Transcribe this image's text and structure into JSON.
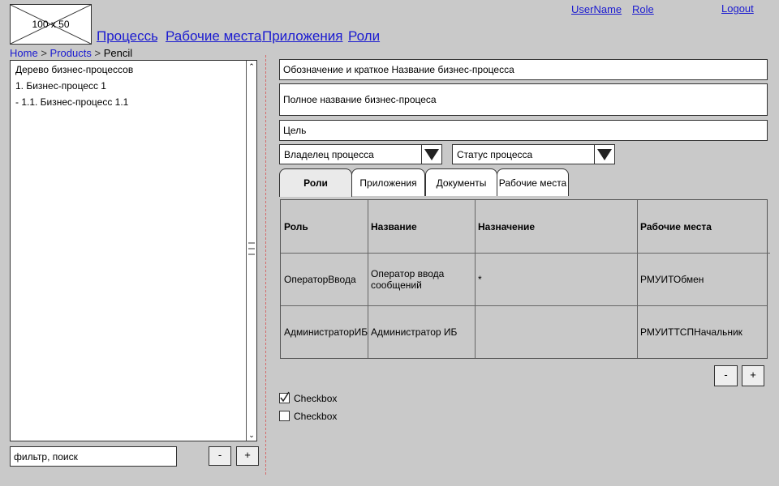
{
  "header": {
    "logo_text": "100 x 50",
    "user_name": "UserName",
    "role": "Role",
    "logout": "Logout",
    "nav": [
      "Процессы",
      "Рабочие места",
      "Приложения",
      "Роли"
    ]
  },
  "breadcrumb": [
    "Home",
    "Products",
    "Pencil"
  ],
  "tree": {
    "items": [
      "Дерево бизнес-процессов",
      "1. Бизнес-процесс 1",
      "- 1.1. Бизнес-процесс 1.1"
    ]
  },
  "filter": {
    "placeholder": "фильтр, поиск",
    "minus_label": "-",
    "plus_label": "+"
  },
  "form": {
    "short_name": "Обозначение и краткое Название бизнес-процесса",
    "full_name": "Полное название бизнес-процеса",
    "goal": "Цель",
    "owner": "Владелец процесса",
    "status": "Статус процесса"
  },
  "tabs": [
    "Роли",
    "Приложения",
    "Документы",
    "Рабочие места"
  ],
  "table": {
    "headers": [
      "Роль",
      "Название",
      "Назначение",
      "Рабочие места"
    ],
    "rows": [
      [
        "ОператорВвода",
        "Оператор ввода сообщений",
        "*",
        "РМУИТОбмен"
      ],
      [
        "АдминистраторИБ",
        "Администратор ИБ",
        "",
        "РМУИТТСПНачальник"
      ]
    ]
  },
  "table_buttons": {
    "minus_label": "-",
    "plus_label": "+"
  },
  "checkboxes": [
    {
      "label": "Checkbox",
      "checked": true
    },
    {
      "label": "Checkbox",
      "checked": false
    }
  ]
}
